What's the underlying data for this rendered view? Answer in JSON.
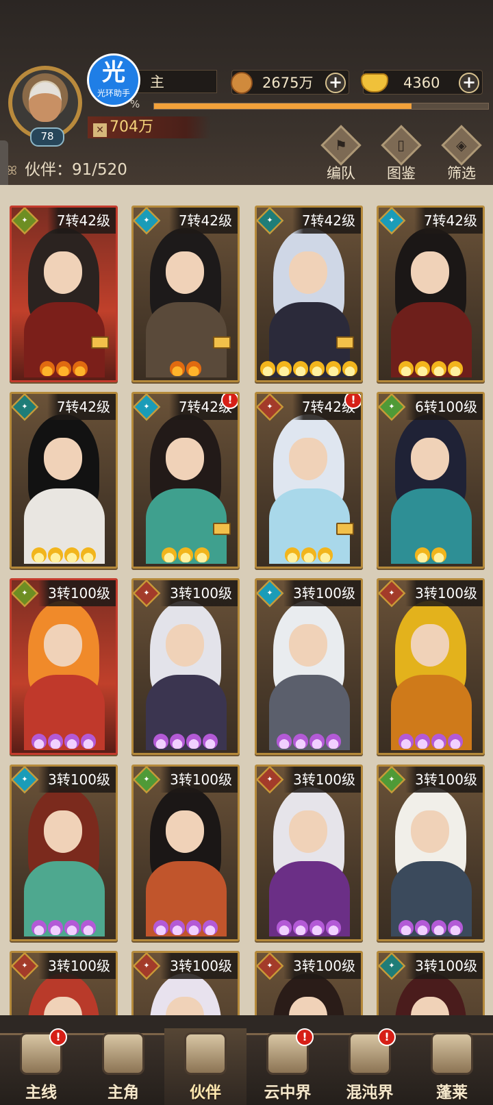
{
  "player": {
    "level": "78",
    "name": "主",
    "exp_label": "%",
    "exp_progress": 0.77,
    "power": "704万",
    "logo_char": "光",
    "logo_text": "光环助手"
  },
  "currency": {
    "coins": "2675万",
    "gold": "4360"
  },
  "partners": {
    "count_label": "伙伴：91/520"
  },
  "top_buttons": [
    {
      "label": "编队",
      "icon": "formation-flag-icon"
    },
    {
      "label": "图鉴",
      "icon": "scroll-book-icon"
    },
    {
      "label": "筛选",
      "icon": "filter-icon"
    }
  ],
  "cards": [
    {
      "level": "7转42级",
      "element": "gold",
      "stars": 3,
      "star_color": "orange",
      "frame": "red",
      "lock": true,
      "alert": false
    },
    {
      "level": "7转42级",
      "element": "wind",
      "stars": 2,
      "star_color": "orange",
      "frame": "gold",
      "lock": true,
      "alert": false
    },
    {
      "level": "7转42级",
      "element": "dark",
      "stars": 6,
      "star_color": "gold",
      "frame": "gold",
      "lock": true,
      "alert": false
    },
    {
      "level": "7转42级",
      "element": "wind",
      "stars": 4,
      "star_color": "gold",
      "frame": "gold",
      "lock": false,
      "alert": false
    },
    {
      "level": "7转42级",
      "element": "dark",
      "stars": 4,
      "star_color": "gold",
      "frame": "gold",
      "lock": false,
      "alert": false
    },
    {
      "level": "7转42级",
      "element": "wind",
      "stars": 3,
      "star_color": "gold",
      "frame": "gold",
      "lock": true,
      "alert": true
    },
    {
      "level": "7转42级",
      "element": "fire",
      "stars": 3,
      "star_color": "gold",
      "frame": "gold",
      "lock": true,
      "alert": true
    },
    {
      "level": "6转100级",
      "element": "wood",
      "stars": 2,
      "star_color": "gold",
      "frame": "gold",
      "lock": false,
      "alert": false
    },
    {
      "level": "3转100级",
      "element": "gold",
      "stars": 4,
      "star_color": "purple",
      "frame": "red",
      "lock": false,
      "alert": false
    },
    {
      "level": "3转100级",
      "element": "fire",
      "stars": 4,
      "star_color": "purple",
      "frame": "gold",
      "lock": false,
      "alert": false
    },
    {
      "level": "3转100级",
      "element": "wind",
      "stars": 4,
      "star_color": "purple",
      "frame": "gold",
      "lock": false,
      "alert": false
    },
    {
      "level": "3转100级",
      "element": "fire",
      "stars": 4,
      "star_color": "purple",
      "frame": "gold",
      "lock": false,
      "alert": false
    },
    {
      "level": "3转100级",
      "element": "wind",
      "stars": 4,
      "star_color": "purple",
      "frame": "gold",
      "lock": false,
      "alert": false
    },
    {
      "level": "3转100级",
      "element": "wood",
      "stars": 4,
      "star_color": "purple",
      "frame": "gold",
      "lock": false,
      "alert": false
    },
    {
      "level": "3转100级",
      "element": "fire",
      "stars": 4,
      "star_color": "purple",
      "frame": "gold",
      "lock": false,
      "alert": false
    },
    {
      "level": "3转100级",
      "element": "wood",
      "stars": 4,
      "star_color": "purple",
      "frame": "gold",
      "lock": false,
      "alert": false
    },
    {
      "level": "3转100级",
      "element": "fire",
      "stars": 0,
      "star_color": "purple",
      "frame": "gold",
      "lock": false,
      "alert": false
    },
    {
      "level": "3转100级",
      "element": "fire",
      "stars": 0,
      "star_color": "purple",
      "frame": "gold",
      "lock": false,
      "alert": false
    },
    {
      "level": "3转100级",
      "element": "fire",
      "stars": 0,
      "star_color": "purple",
      "frame": "gold",
      "lock": false,
      "alert": false
    },
    {
      "level": "3转100级",
      "element": "dark",
      "stars": 0,
      "star_color": "purple",
      "frame": "gold",
      "lock": false,
      "alert": false
    }
  ],
  "nav": [
    {
      "label": "主线",
      "icon": "crossed-swords-icon",
      "alert": true,
      "active": false
    },
    {
      "label": "主角",
      "icon": "hero-portrait-icon",
      "alert": false,
      "active": false
    },
    {
      "label": "伙伴",
      "icon": "partner-helmet-icon",
      "alert": false,
      "active": true
    },
    {
      "label": "云中界",
      "icon": "cloud-palace-icon",
      "alert": true,
      "active": false
    },
    {
      "label": "混沌界",
      "icon": "chaos-gate-icon",
      "alert": true,
      "active": false
    },
    {
      "label": "蓬莱",
      "icon": "penglai-elder-icon",
      "alert": false,
      "active": false
    }
  ],
  "colors": {
    "accent": "#f2a13a",
    "frame_gold": "#b58a3b",
    "frame_red": "#c43b2d",
    "alert_red": "#d61f17"
  }
}
